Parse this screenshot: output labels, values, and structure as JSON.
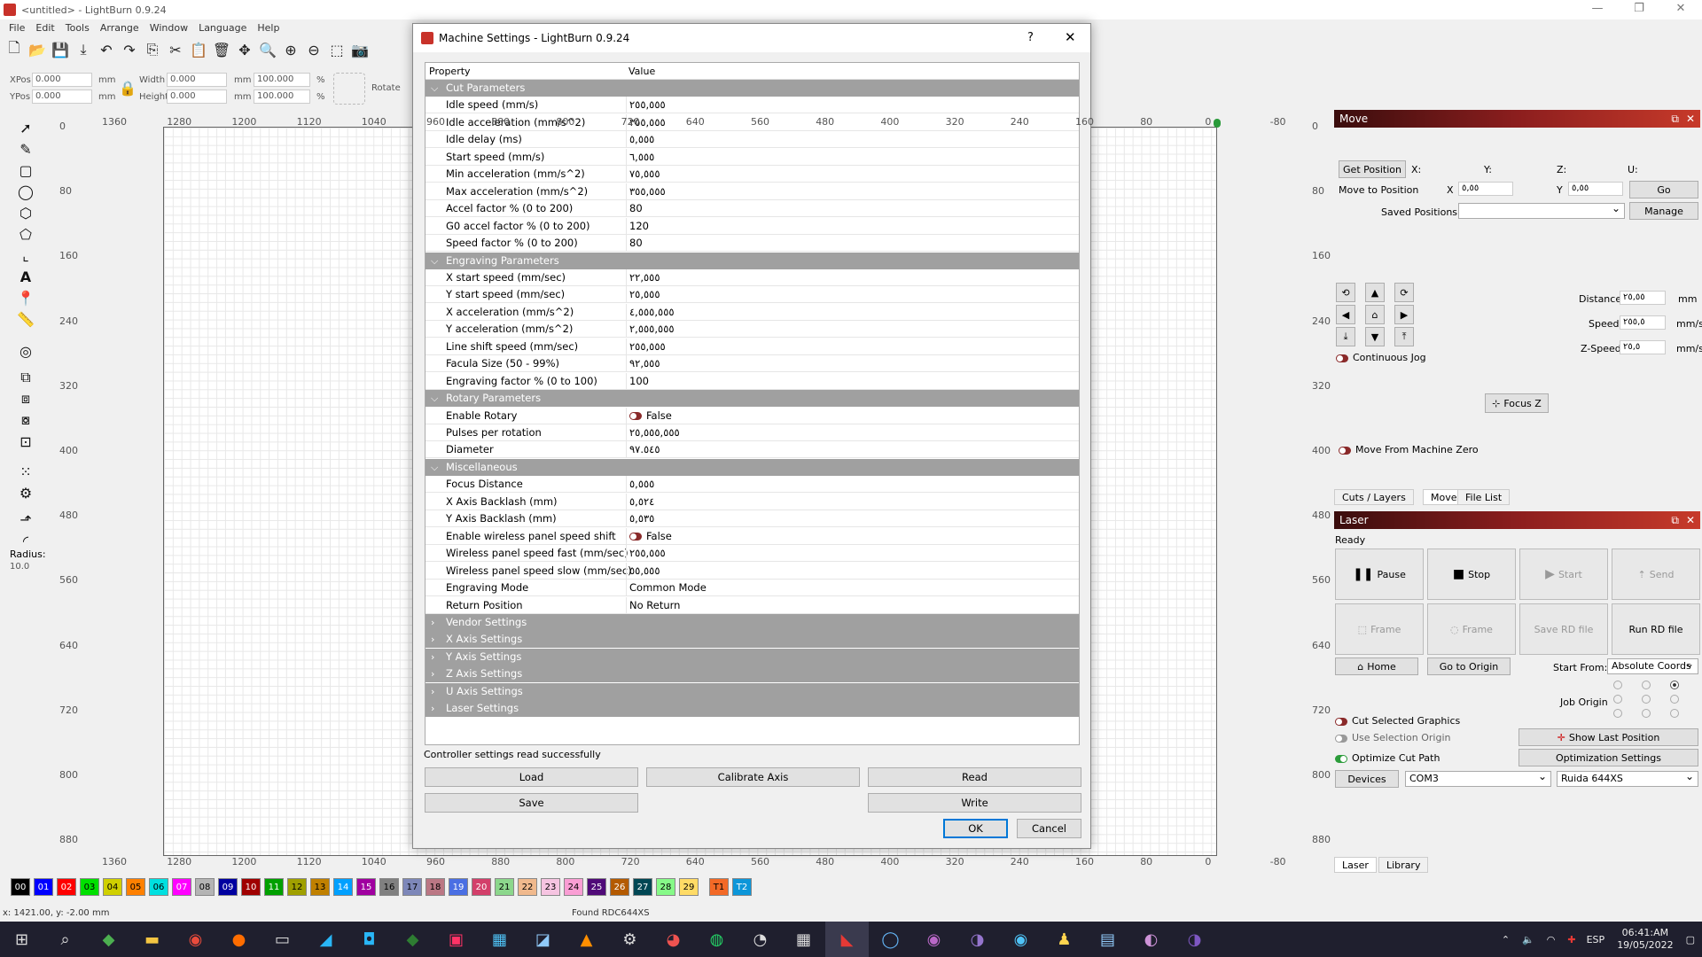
{
  "window": {
    "title": "<untitled> - LightBurn 0.9.24",
    "min": "—",
    "max": "❐",
    "close": "✕"
  },
  "menu": [
    "File",
    "Edit",
    "Tools",
    "Arrange",
    "Window",
    "Language",
    "Help"
  ],
  "posbar": {
    "xpos_label": "XPos",
    "xpos": "0.000",
    "ypos_label": "YPos",
    "ypos": "0.000",
    "unit": "mm",
    "width_label": "Width",
    "width": "0.000",
    "height_label": "Height",
    "height": "0.000",
    "wpct": "100.000",
    "hpct": "100.000",
    "pct": "%",
    "rotate_label": "Rotate"
  },
  "lefttools": {
    "radius_label": "Radius:",
    "radius": "10.0"
  },
  "rulers": {
    "top": [
      "1360",
      "1280",
      "1200",
      "1120",
      "1040",
      "960",
      "880",
      "800",
      "720",
      "640",
      "560",
      "480",
      "400",
      "320",
      "240",
      "160",
      "80",
      "0",
      "-80"
    ],
    "bottom": [
      "1360",
      "1280",
      "1200",
      "1120",
      "1040",
      "960",
      "880",
      "800",
      "720",
      "640",
      "560",
      "480",
      "400",
      "320",
      "240",
      "160",
      "80",
      "0",
      "-80"
    ],
    "left": [
      "0",
      "80",
      "160",
      "240",
      "320",
      "400",
      "480",
      "560",
      "640",
      "720",
      "800",
      "880"
    ],
    "right": [
      "0",
      "80",
      "160",
      "240",
      "320",
      "400",
      "480",
      "560",
      "640",
      "720",
      "800",
      "880"
    ]
  },
  "move_panel": {
    "title": "Move",
    "get_position": "Get Position",
    "x": "X:",
    "y": "Y:",
    "z": "Z:",
    "u": "U:",
    "move_to_position": "Move to Position",
    "mx_label": "X",
    "mx": "٥,٥٥",
    "my_label": "Y",
    "my": "٥,٥٥",
    "go": "Go",
    "saved_positions": "Saved Positions:",
    "manage": "Manage",
    "distance_label": "Distance",
    "distance": "٢٥,٥٥",
    "distance_unit": "mm",
    "speed_label": "Speed",
    "speed": "٢٥٥,٥",
    "speed_unit": "mm/s",
    "zspeed_label": "Z-Speed",
    "zspeed": "٢٥,٥",
    "zspeed_unit": "mm/s",
    "continuous_jog": "Continuous Jog",
    "focus_z": "Focus Z",
    "move_from_zero": "Move From Machine Zero"
  },
  "mid_tabs": [
    "Cuts / Layers",
    "Move",
    "File List"
  ],
  "laser_panel": {
    "title": "Laser",
    "state": "Ready",
    "pause": "Pause",
    "stop": "Stop",
    "start": "Start",
    "send": "Send",
    "frame1": "Frame",
    "frame2": "Frame",
    "save_rd": "Save RD file",
    "run_rd": "Run RD file",
    "home": "Home",
    "go_origin": "Go to Origin",
    "start_from_label": "Start From:",
    "start_from": "Absolute Coords",
    "job_origin": "Job Origin",
    "cut_selected": "Cut Selected Graphics",
    "use_sel_origin": "Use Selection Origin",
    "optimize": "Optimize Cut Path",
    "show_last": "Show Last Position",
    "opt_settings": "Optimization Settings",
    "devices": "Devices",
    "port": "COM3",
    "device": "Ruida 644XS"
  },
  "bottom_tabs": [
    "Laser",
    "Library"
  ],
  "palette": [
    {
      "n": "00",
      "c": "#000000",
      "f": "#ffffff"
    },
    {
      "n": "01",
      "c": "#0000ff",
      "f": "#ffffff"
    },
    {
      "n": "02",
      "c": "#ff0000",
      "f": "#ffffff"
    },
    {
      "n": "03",
      "c": "#00e000",
      "f": "#000000"
    },
    {
      "n": "04",
      "c": "#d0d000",
      "f": "#000000"
    },
    {
      "n": "05",
      "c": "#ff8000",
      "f": "#000000"
    },
    {
      "n": "06",
      "c": "#00e0e0",
      "f": "#000000"
    },
    {
      "n": "07",
      "c": "#ff00ff",
      "f": "#ffffff"
    },
    {
      "n": "08",
      "c": "#b4b4b4",
      "f": "#000000"
    },
    {
      "n": "09",
      "c": "#0000a0",
      "f": "#ffffff"
    },
    {
      "n": "10",
      "c": "#a00000",
      "f": "#ffffff"
    },
    {
      "n": "11",
      "c": "#00a000",
      "f": "#ffffff"
    },
    {
      "n": "12",
      "c": "#a0a000",
      "f": "#000000"
    },
    {
      "n": "13",
      "c": "#c08000",
      "f": "#000000"
    },
    {
      "n": "14",
      "c": "#00a0ff",
      "f": "#ffffff"
    },
    {
      "n": "15",
      "c": "#a000a0",
      "f": "#ffffff"
    },
    {
      "n": "16",
      "c": "#808080",
      "f": "#000000"
    },
    {
      "n": "17",
      "c": "#7d87b9",
      "f": "#000000"
    },
    {
      "n": "18",
      "c": "#bb7784",
      "f": "#000000"
    },
    {
      "n": "19",
      "c": "#4a6fe3",
      "f": "#ffffff"
    },
    {
      "n": "20",
      "c": "#d33f6a",
      "f": "#ffffff"
    },
    {
      "n": "21",
      "c": "#8cd78c",
      "f": "#000000"
    },
    {
      "n": "22",
      "c": "#f0b98d",
      "f": "#000000"
    },
    {
      "n": "23",
      "c": "#f6c4e1",
      "f": "#000000"
    },
    {
      "n": "24",
      "c": "#fa9ed4",
      "f": "#000000"
    },
    {
      "n": "25",
      "c": "#500a78",
      "f": "#ffffff"
    },
    {
      "n": "26",
      "c": "#b45a00",
      "f": "#ffffff"
    },
    {
      "n": "27",
      "c": "#004754",
      "f": "#ffffff"
    },
    {
      "n": "28",
      "c": "#86fa88",
      "f": "#000000"
    },
    {
      "n": "29",
      "c": "#ffdb66",
      "f": "#000000"
    },
    {
      "n": "T1",
      "c": "#f36926",
      "f": "#000000"
    },
    {
      "n": "T2",
      "c": "#0c96d9",
      "f": "#ffffff"
    }
  ],
  "statusbar": {
    "coords": "x: 1421.00, y: -2.00 mm",
    "found": "Found RDC644XS"
  },
  "dialog": {
    "title": "Machine Settings - LightBurn 0.9.24",
    "help": "?",
    "close": "✕",
    "col_property": "Property",
    "col_value": "Value",
    "sections": [
      {
        "name": "Cut Parameters",
        "open": true,
        "rows": [
          {
            "k": "Idle speed (mm/s)",
            "v": "٢٥٥,٥٥٥"
          },
          {
            "k": "Idle acceleration (mm/s^2)",
            "v": "٣٥٥,٥٥٥"
          },
          {
            "k": "Idle delay (ms)",
            "v": "٥,٥٥٥"
          },
          {
            "k": "Start speed (mm/s)",
            "v": "٦,٥٥٥"
          },
          {
            "k": "Min acceleration (mm/s^2)",
            "v": "٧٥,٥٥٥"
          },
          {
            "k": "Max acceleration (mm/s^2)",
            "v": "٣٥٥,٥٥٥"
          },
          {
            "k": "Accel factor % (0 to 200)",
            "v": "80"
          },
          {
            "k": "G0 accel factor % (0 to 200)",
            "v": "120"
          },
          {
            "k": "Speed factor % (0 to 200)",
            "v": "80"
          }
        ]
      },
      {
        "name": "Engraving Parameters",
        "open": true,
        "rows": [
          {
            "k": "X start speed (mm/sec)",
            "v": "٢٢,٥٥٥"
          },
          {
            "k": "Y start speed (mm/sec)",
            "v": "٢٥,٥٥٥"
          },
          {
            "k": "X acceleration (mm/s^2)",
            "v": "٤,٥٥٥,٥٥٥"
          },
          {
            "k": "Y acceleration (mm/s^2)",
            "v": "٢,٥٥٥,٥٥٥"
          },
          {
            "k": "Line shift speed (mm/sec)",
            "v": "٢٥٥,٥٥٥"
          },
          {
            "k": "Facula Size (50 - 99%)",
            "v": "٩٢,٥٥٥"
          },
          {
            "k": "Engraving factor % (0 to 100)",
            "v": "100"
          }
        ]
      },
      {
        "name": "Rotary Parameters",
        "open": true,
        "rows": [
          {
            "k": "Enable Rotary",
            "v": "False",
            "toggle": true
          },
          {
            "k": "Pulses per rotation",
            "v": "٢٥,٥٥٥,٥٥٥"
          },
          {
            "k": "Diameter",
            "v": "٩٧.٥٤٥"
          }
        ]
      },
      {
        "name": "Miscellaneous",
        "open": true,
        "rows": [
          {
            "k": "Focus Distance",
            "v": "٥,٥٥٥"
          },
          {
            "k": "X Axis Backlash (mm)",
            "v": "٥,٥٢٤"
          },
          {
            "k": "Y Axis Backlash (mm)",
            "v": "٥,٥٣٥"
          },
          {
            "k": "Enable wireless panel speed shift",
            "v": "False",
            "toggle": true
          },
          {
            "k": "Wireless panel speed fast (mm/sec)",
            "v": "٢٥٥,٥٥٥"
          },
          {
            "k": "Wireless panel speed slow (mm/sec)",
            "v": "٥٥,٥٥٥"
          },
          {
            "k": "Engraving Mode",
            "v": "Common Mode"
          },
          {
            "k": "Return Position",
            "v": "No Return"
          }
        ]
      },
      {
        "name": "Vendor Settings",
        "open": false,
        "rows": []
      },
      {
        "name": "X Axis Settings",
        "open": false,
        "rows": []
      },
      {
        "name": "Y Axis Settings",
        "open": false,
        "rows": []
      },
      {
        "name": "Z Axis Settings",
        "open": false,
        "rows": []
      },
      {
        "name": "U Axis Settings",
        "open": false,
        "rows": []
      },
      {
        "name": "Laser Settings",
        "open": false,
        "rows": []
      }
    ],
    "status": "Controller settings read successfully",
    "load": "Load",
    "calibrate": "Calibrate Axis",
    "read": "Read",
    "save": "Save",
    "write": "Write",
    "ok": "OK",
    "cancel": "Cancel"
  },
  "tray": {
    "lang": "ESP",
    "time": "06:41:AM",
    "date": "19/05/2022"
  }
}
